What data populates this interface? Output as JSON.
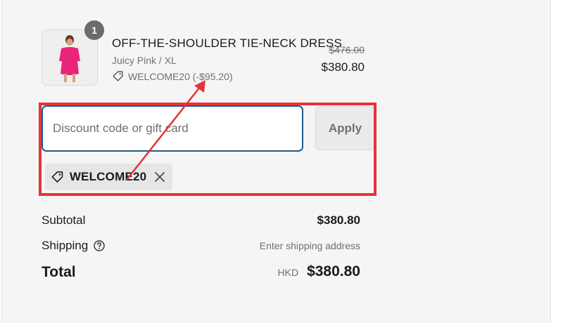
{
  "product": {
    "quantity": "1",
    "title": "OFF-THE-SHOULDER TIE-NECK DRESS",
    "variant": "Juicy Pink / XL",
    "discount_applied": "WELCOME20 (-$95.20)",
    "compare_price": "$476.00",
    "price": "$380.80",
    "image_icon": "dress-product-image"
  },
  "discount_form": {
    "placeholder": "Discount code or gift card",
    "value": "",
    "apply_label": "Apply"
  },
  "applied_code": {
    "label": "WELCOME20",
    "icon": "tag-icon",
    "remove_icon": "close-icon"
  },
  "summary": {
    "subtotal_label": "Subtotal",
    "subtotal_value": "$380.80",
    "shipping_label": "Shipping",
    "shipping_value": "Enter shipping address",
    "shipping_help_icon": "help-circle-icon",
    "total_label": "Total",
    "currency": "HKD",
    "total_value": "$380.80"
  },
  "colors": {
    "background": "#f5f5f5",
    "input_border": "#1f5a8a",
    "annotation_red": "#e5343a",
    "product_pink": "#e8257a"
  }
}
